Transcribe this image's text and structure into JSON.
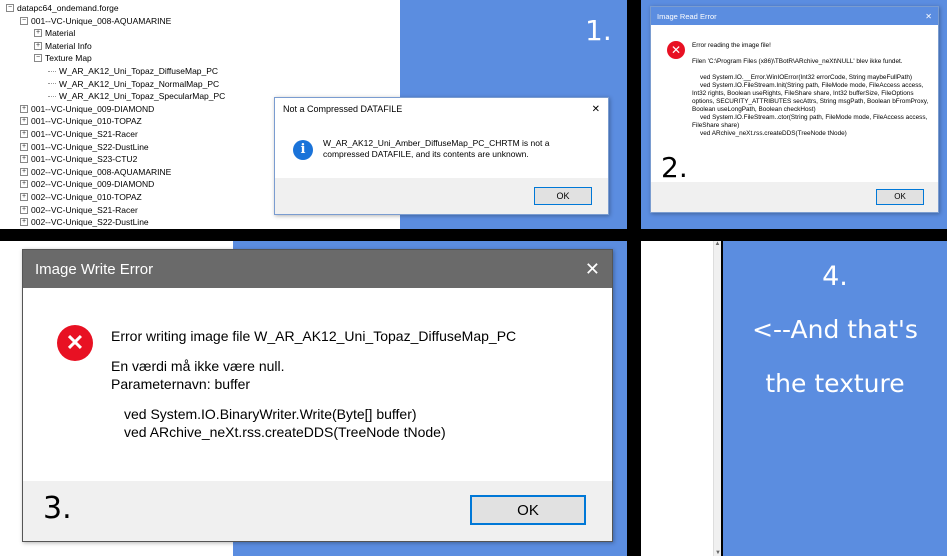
{
  "panel1": {
    "number": "1.",
    "tree": {
      "root": "datapc64_ondemand.forge",
      "items": [
        {
          "label": "001--VC-Unique_008-AQUAMARINE",
          "exp": "⊟",
          "indent": 1
        },
        {
          "label": "Material",
          "exp": "⊞",
          "indent": 2
        },
        {
          "label": "Material Info",
          "exp": "⊞",
          "indent": 2
        },
        {
          "label": "Texture Map",
          "exp": "⊟",
          "indent": 2
        },
        {
          "label": "W_AR_AK12_Uni_Topaz_DiffuseMap_PC",
          "exp": "",
          "indent": 3
        },
        {
          "label": "W_AR_AK12_Uni_Topaz_NormalMap_PC",
          "exp": "",
          "indent": 3
        },
        {
          "label": "W_AR_AK12_Uni_Topaz_SpecularMap_PC",
          "exp": "",
          "indent": 3
        },
        {
          "label": "001--VC-Unique_009-DIAMOND",
          "exp": "⊞",
          "indent": 1
        },
        {
          "label": "001--VC-Unique_010-TOPAZ",
          "exp": "⊞",
          "indent": 1
        },
        {
          "label": "001--VC-Unique_S21-Racer",
          "exp": "⊞",
          "indent": 1
        },
        {
          "label": "001--VC-Unique_S22-DustLine",
          "exp": "⊞",
          "indent": 1
        },
        {
          "label": "001--VC-Unique_S23-CTU2",
          "exp": "⊞",
          "indent": 1
        },
        {
          "label": "002--VC-Unique_008-AQUAMARINE",
          "exp": "⊞",
          "indent": 1
        },
        {
          "label": "002--VC-Unique_009-DIAMOND",
          "exp": "⊞",
          "indent": 1
        },
        {
          "label": "002--VC-Unique_010-TOPAZ",
          "exp": "⊞",
          "indent": 1
        },
        {
          "label": "002--VC-Unique_S21-Racer",
          "exp": "⊞",
          "indent": 1
        },
        {
          "label": "002--VC-Unique_S22-DustLine",
          "exp": "⊞",
          "indent": 1
        }
      ]
    },
    "dialog": {
      "title": "Not a Compressed DATAFILE",
      "message": "W_AR_AK12_Uni_Amber_DiffuseMap_PC_CHRTM is not a compressed DATAFILE, and its contents are unknown.",
      "ok": "OK",
      "close": "✕",
      "icon": "i"
    }
  },
  "panel2": {
    "number": "2.",
    "dialog": {
      "title": "Image Read Error",
      "heading": "Error reading the image file!",
      "line1": "Filen 'C:\\Program Files (x86)\\TBotR\\ARchive_neXt\\NULL' blev ikke fundet.",
      "stack": [
        "ved System.IO.__Error.WinIOError(Int32 errorCode, String maybeFullPath)",
        "ved System.IO.FileStream.Init(String path, FileMode mode, FileAccess access, Int32 rights, Boolean useRights, FileShare share, Int32 bufferSize, FileOptions options, SECURITY_ATTRIBUTES secAttrs, String msgPath, Boolean bFromProxy, Boolean useLongPath, Boolean checkHost)",
        "ved System.IO.FileStream..ctor(String path, FileMode mode, FileAccess access, FileShare share)",
        "ved ARchive_neXt.rss.createDDS(TreeNode tNode)"
      ],
      "ok": "OK",
      "close": "✕"
    }
  },
  "panel3": {
    "number": "3.",
    "dialog": {
      "title": "Image Write Error",
      "heading": "Error writing image file W_AR_AK12_Uni_Topaz_DiffuseMap_PC",
      "line1": "En værdi må ikke være null.",
      "line2": "Parameternavn: buffer",
      "stack1": "ved System.IO.BinaryWriter.Write(Byte[] buffer)",
      "stack2": "ved ARchive_neXt.rss.createDDS(TreeNode tNode)",
      "ok": "OK",
      "close": "✕"
    }
  },
  "panel4": {
    "number": "4.",
    "line1": "<--And that's",
    "line2": "the texture"
  },
  "colors": {
    "blue": "#5b8de0",
    "error_red": "#e81123",
    "info_blue": "#1a73d9"
  }
}
